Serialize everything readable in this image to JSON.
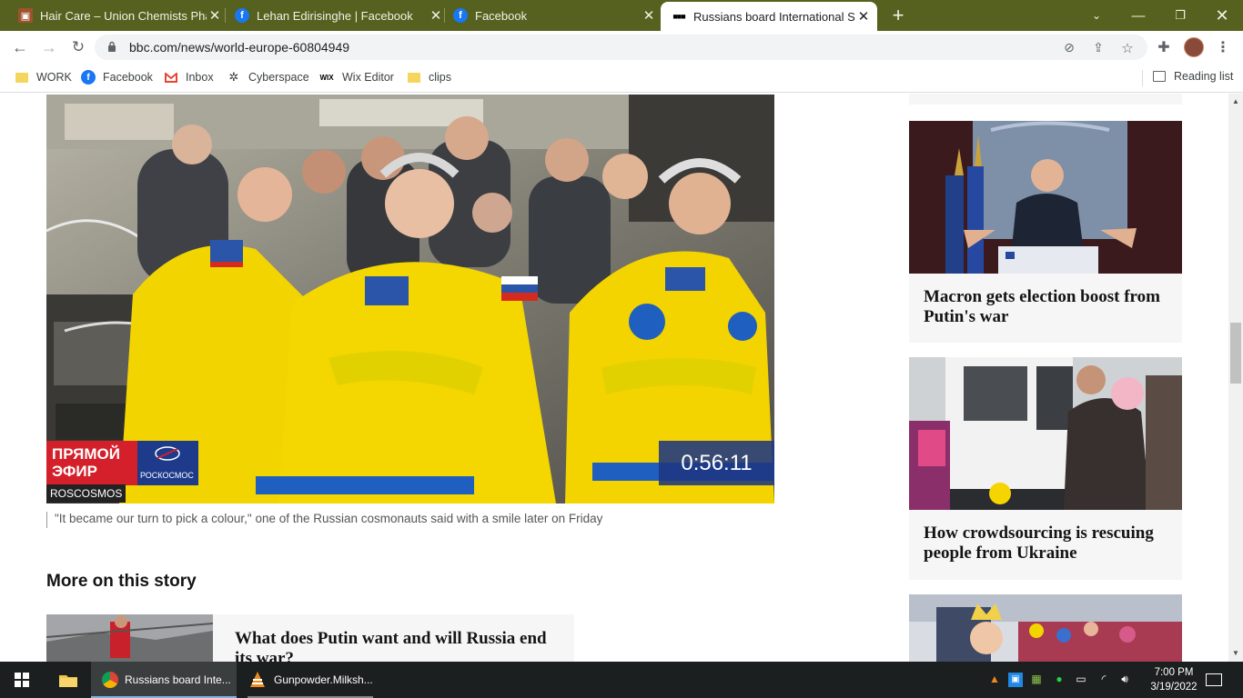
{
  "tabs": [
    {
      "title": "Hair Care – Union Chemists Phar",
      "icon": "union-chemists-icon",
      "close": "✕"
    },
    {
      "title": "Lehan Edirisinghe | Facebook",
      "icon": "facebook-icon",
      "close": "✕"
    },
    {
      "title": "Facebook",
      "icon": "facebook-icon",
      "close": "✕"
    },
    {
      "title": "Russians board International Spa",
      "icon": "bbc-icon",
      "close": "✕",
      "active": true
    }
  ],
  "new_tab": "+",
  "address": {
    "url": "bbc.com/news/world-europe-60804949"
  },
  "bookmarks": [
    {
      "label": "WORK",
      "icon": "folder-icon"
    },
    {
      "label": "Facebook",
      "icon": "facebook-icon"
    },
    {
      "label": "Inbox",
      "icon": "gmail-icon"
    },
    {
      "label": "Cyberspace",
      "icon": "cyberspace-icon"
    },
    {
      "label": "Wix Editor",
      "icon": "wix-icon",
      "icon_text": "WIX"
    },
    {
      "label": "clips",
      "icon": "folder-icon"
    }
  ],
  "reading_list": "Reading list",
  "article": {
    "video_overlay": {
      "live_badge_line1": "ПРЯМОЙ",
      "live_badge_line2": "ЭФИР",
      "roscosmos_logo_text": "РОСКОСМОС",
      "timer": "0:56:11",
      "credit": "ROSCOSMOS"
    },
    "caption": "\"It became our turn to pick a colour,\" one of the Russian cosmonauts said with a smile later on Friday",
    "more_on_story": "More on this story",
    "related": [
      {
        "headline": "What does Putin want and will Russia end its war?"
      }
    ]
  },
  "sidebar": {
    "cards": [
      {
        "headline": "Macron gets election boost from Putin's war"
      },
      {
        "headline": "How crowdsourcing is rescuing people from Ukraine"
      }
    ]
  },
  "taskbar": {
    "items": [
      {
        "label": "Russians board Inte...",
        "icon": "chrome-icon",
        "active": true
      },
      {
        "label": "Gunpowder.Milksh...",
        "icon": "vlc-icon"
      }
    ],
    "time": "7:00 PM",
    "date": "3/19/2022"
  },
  "colors": {
    "tab_bar": "#56601f",
    "facebook": "#1877f2",
    "suit_yellow": "#f2d400",
    "taskbar": "#1c1f1f"
  }
}
